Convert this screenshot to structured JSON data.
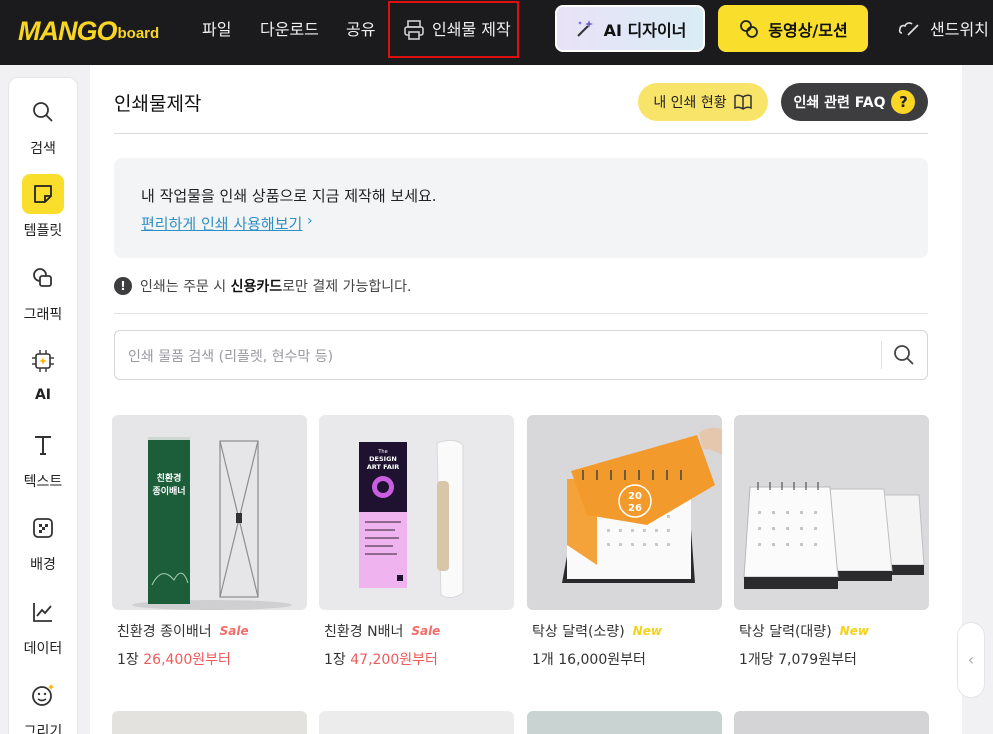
{
  "topbar": {
    "logo_main": "MANGO",
    "logo_sub": "board",
    "nav": [
      "파일",
      "다운로드",
      "공유"
    ],
    "print_label": "인쇄물 제작",
    "ai_label": "AI 디자이너",
    "video_label": "동영상/모션",
    "sand_label": "샌드위치"
  },
  "sidebar": {
    "items": [
      {
        "label": "검색",
        "icon": "search-icon"
      },
      {
        "label": "템플릿",
        "icon": "template-icon"
      },
      {
        "label": "그래픽",
        "icon": "graphic-icon"
      },
      {
        "label": "AI",
        "icon": "ai-chip-icon"
      },
      {
        "label": "텍스트",
        "icon": "text-icon"
      },
      {
        "label": "배경",
        "icon": "background-icon"
      },
      {
        "label": "데이터",
        "icon": "chart-icon"
      },
      {
        "label": "그리기",
        "icon": "draw-icon"
      }
    ]
  },
  "panel": {
    "title": "인쇄물제작",
    "status_label": "내 인쇄 현황",
    "faq_label": "인쇄 관련 FAQ",
    "notice_text": "내 작업물을 인쇄 상품으로 지금 제작해 보세요.",
    "notice_link": "편리하게 인쇄 사용해보기",
    "warn_pre": "인쇄는 주문 시 ",
    "warn_bold": "신용카드",
    "warn_post": "로만 결제 가능합니다.",
    "search_placeholder": "인쇄 물품 검색 (리플렛, 현수막 등)"
  },
  "products": [
    {
      "name": "친환경 종이배너",
      "badge": "Sale",
      "qty": "1장 ",
      "price": "26,400원부터"
    },
    {
      "name": "친환경 N배너",
      "badge": "Sale",
      "qty": "1장 ",
      "price": "47,200원부터"
    },
    {
      "name": "탁상 달력(소량)",
      "badge": "New",
      "qty": "1개 ",
      "price": "16,000원부터"
    },
    {
      "name": "탁상 달력(대량)",
      "badge": "New",
      "qty": "1개당 ",
      "price": "7,079원부터"
    }
  ],
  "thumb_text": {
    "banner_line1": "친환경",
    "banner_line2": "종이배너",
    "poster_line1": "The",
    "poster_line2": "DESIGN",
    "poster_line3": "ART FAIR",
    "calendar_year_top": "20",
    "calendar_year_bottom": "26"
  },
  "colors": {
    "brand_yellow": "#f9d524",
    "topbar_bg": "#1b1b1d",
    "highlight_border": "#e00f0f",
    "sale": "#f26c6c",
    "new": "#f4d21c",
    "price": "#f05a5a",
    "link": "#2f8fc5"
  }
}
